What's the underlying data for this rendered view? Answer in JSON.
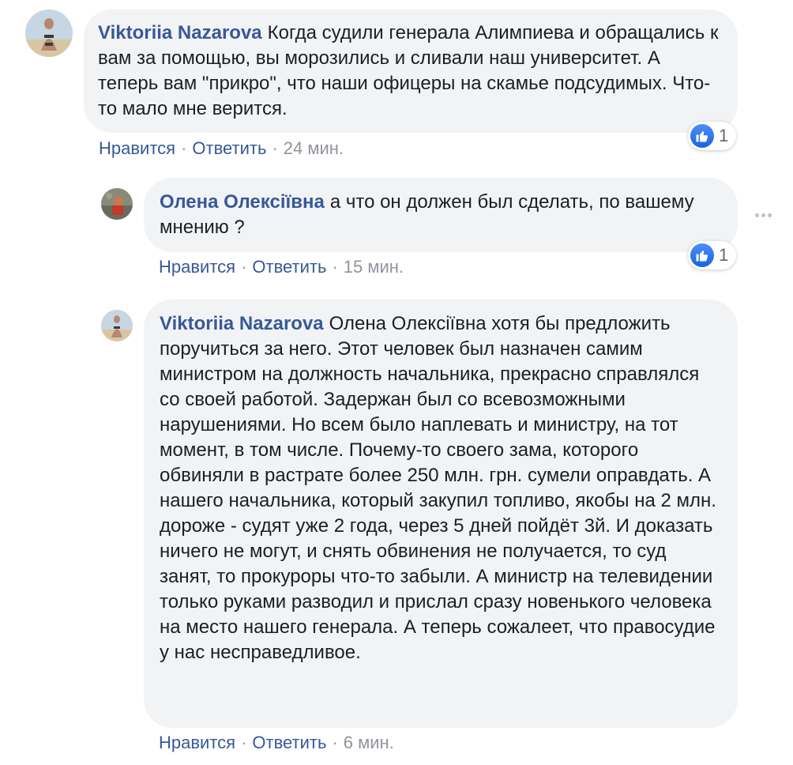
{
  "comments": [
    {
      "author": "Viktoriia Nazarova",
      "text": "Когда судили генерала Алимпиева и обращались к вам за помощью, вы морозились и сливали наш университет. А теперь вам \"прикро\", что наши офицеры на скамье подсудимых. Что-то мало мне верится.",
      "like": "Нравится",
      "reply": "Ответить",
      "sep": "·",
      "time": "24 мин.",
      "reactions": "1",
      "reaction_icon": "thumbs-up-icon"
    },
    {
      "author": "Олена Олексіївна",
      "text": "а что он должен был сделать, по вашему мнению ?",
      "like": "Нравится",
      "reply": "Ответить",
      "sep": "·",
      "time": "15 мин.",
      "reactions": "1",
      "reaction_icon": "thumbs-up-icon"
    },
    {
      "author": "Viktoriia Nazarova",
      "text": "Олена Олексіївна хотя бы предложить поручиться за него. Этот человек был назначен самим министром на должность начальника, прекрасно справлялся со своей работой. Задержан был со всевозможными нарушениями. Но всем было наплевать и министру, на тот момент, в том числе. Почему-то своего зама, которого обвиняли в растрате более 250 млн. грн. сумели оправдать. А нашего начальника, который закупил топливо, якобы на 2 млн. дороже - судят уже 2 года, через 5 дней пойдёт 3й. И доказать ничего не могут, и снять обвинения не получается, то суд занят, то прокуроры что-то забыли. А министр на телевидении только руками разводил и прислал сразу новенького человека на место нашего генерала. А теперь сожалеет, что правосудие у нас несправедливое.",
      "like": "Нравится",
      "reply": "Ответить",
      "sep": "·",
      "time": "6 мин."
    }
  ],
  "colors": {
    "link": "#385898",
    "bubble": "#f2f3f5",
    "meta": "#90949c",
    "like_blue": "#1877f2"
  },
  "icons": {
    "more": "more-options-icon",
    "avatar": "avatar"
  }
}
